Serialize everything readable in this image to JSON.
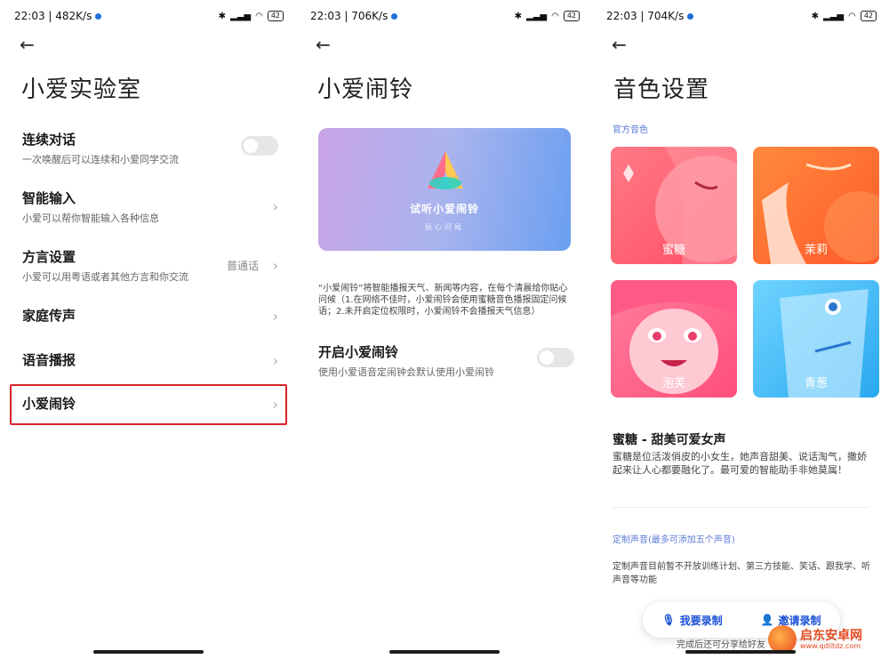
{
  "panels": [
    {
      "status": {
        "time": "22:03",
        "speed": "482K/s",
        "battery": "42"
      },
      "title": "小爱实验室",
      "items": [
        {
          "title": "连续对话",
          "subtitle": "一次唤醒后可以连续和小爱同学交流"
        },
        {
          "title": "智能输入",
          "subtitle": "小爱可以帮你智能输入各种信息"
        },
        {
          "title": "方言设置",
          "subtitle": "小爱可以用粤语或者其他方言和你交流",
          "value": "普通话"
        },
        {
          "title": "家庭传声"
        },
        {
          "title": "语音播报"
        },
        {
          "title": "小爱闹铃"
        }
      ]
    },
    {
      "status": {
        "time": "22:03",
        "speed": "706K/s",
        "battery": "42"
      },
      "title": "小爱闹铃",
      "banner": {
        "title": "试听小爱闹铃",
        "subtitle": "贴心问候"
      },
      "description": "“小爱闹铃”将智能播报天气、新闻等内容，在每个清晨给你贴心问候（1.在网络不佳时，小爱闹铃会使用蜜糖音色播报固定问候语；2.未开启定位权限时，小爱闹铃不会播报天气信息）",
      "setting": {
        "title": "开启小爱闹铃",
        "subtitle": "使用小爱语音定闹钟会默认使用小爱闹铃"
      }
    },
    {
      "status": {
        "time": "22:03",
        "speed": "704K/s",
        "battery": "42"
      },
      "title": "音色设置",
      "official_label": "官方音色",
      "voices": [
        "蜜糖",
        "茉莉",
        "泡芙",
        "青葱"
      ],
      "voice_name": "蜜糖 - 甜美可爱女声",
      "voice_desc": "蜜糖是位活泼俏皮的小女生，她声音甜美、说话淘气，撒娇起来让人心都要融化了。最可爱的智能助手非她莫属！",
      "custom_label": "定制声音(最多可添加五个声音)",
      "custom_desc": "定制声音目前暂不开放训练计划、第三方技能、笑话、跟我学、听声音等功能",
      "record_btn": "我要录制",
      "invite_btn": "邀请录制",
      "under_text": "完成后还可分享给好友",
      "watermark": {
        "name": "启东安卓网",
        "url": "www.qdlitdz.com"
      }
    }
  ],
  "colors": {
    "highlight": "#d9222a",
    "accent_blue": "#1a4fd6",
    "section_blue": "#5b7ad6",
    "toggle_off": "#e6e6e6"
  }
}
